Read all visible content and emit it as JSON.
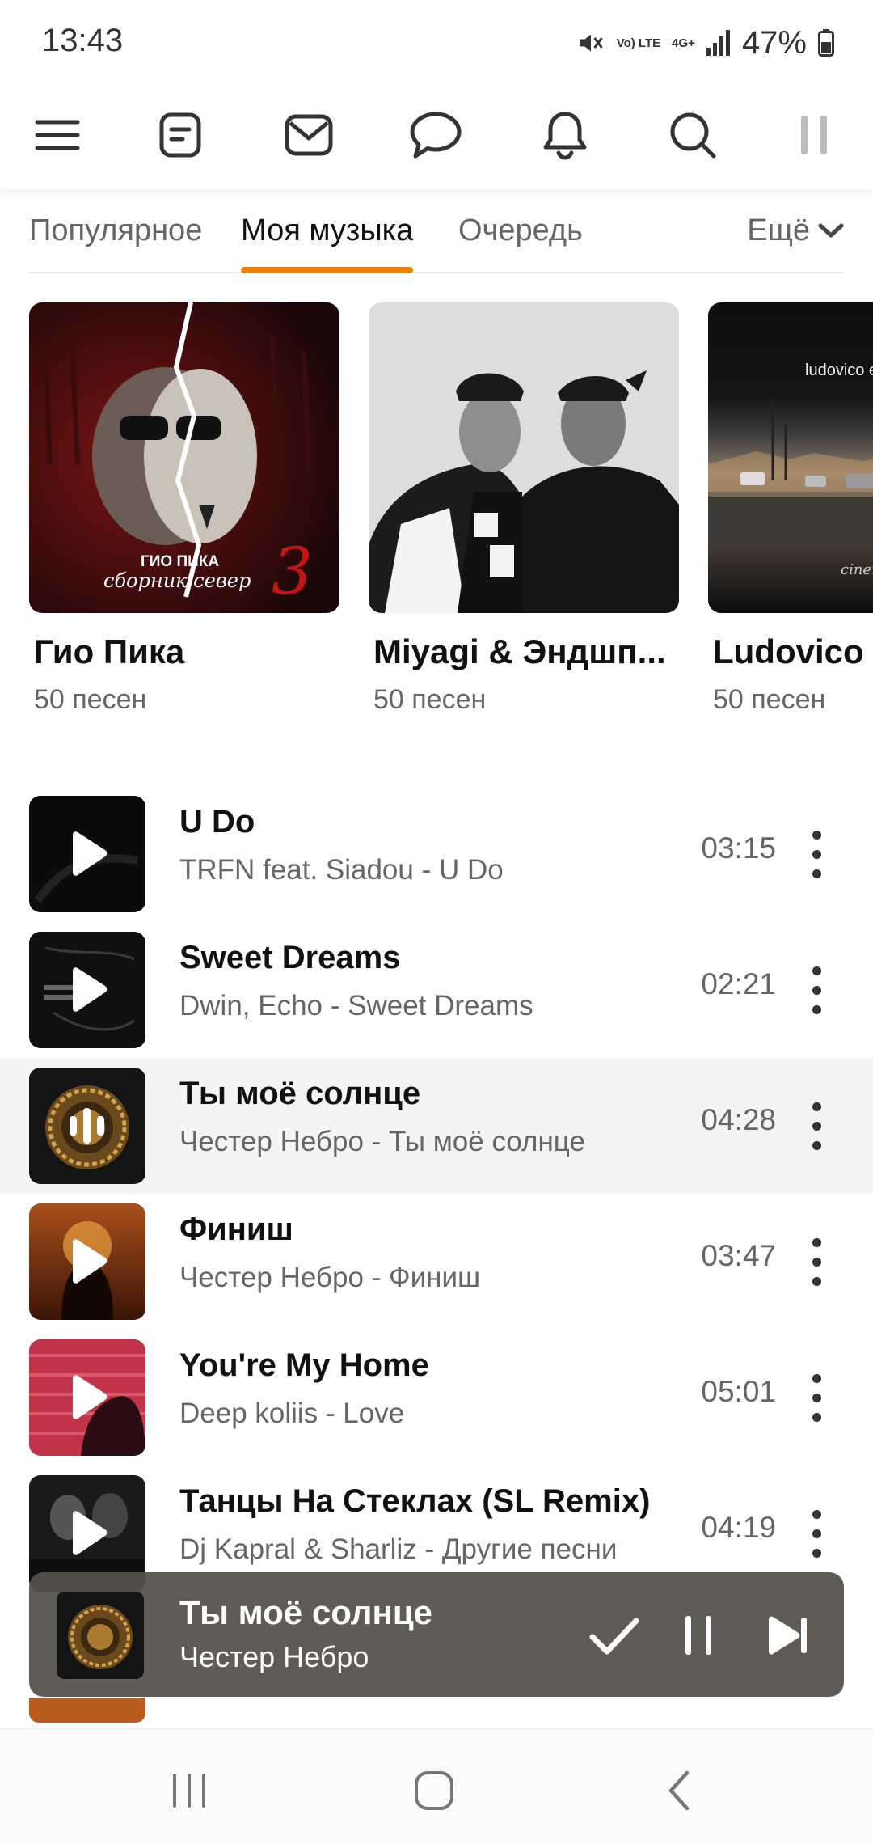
{
  "status_bar": {
    "time": "13:43",
    "lte_top": "Vo) LTE",
    "net_label": "4G+",
    "battery": "47%"
  },
  "toolbar": {
    "icons": [
      "menu-icon",
      "feed-icon",
      "mail-icon",
      "chat-icon",
      "bell-icon",
      "search-icon",
      "pause-icon"
    ]
  },
  "tabs": {
    "items": [
      "Популярное",
      "Моя музыка",
      "Очередь"
    ],
    "active_index": 1,
    "more_label": "Ещё"
  },
  "artist_cards": [
    {
      "title": "Гио Пика",
      "subtitle": "50 песен",
      "cover_text_1": "ГИО ПИКА",
      "cover_text_2": "сборник север",
      "cover_text_3": "3"
    },
    {
      "title": "Miyagi & Эндшп...",
      "subtitle": "50 песен"
    },
    {
      "title": "Ludovico I",
      "subtitle": "50 песен",
      "cover_text_1": "ludovico e",
      "cover_text_2": "cinem"
    }
  ],
  "tracks": [
    {
      "title": "U Do",
      "artist": "TRFN feat. Siadou - U Do",
      "duration": "03:15",
      "state": "play"
    },
    {
      "title": "Sweet Dreams",
      "artist": "Dwin, Echo - Sweet Dreams",
      "duration": "02:21",
      "state": "play"
    },
    {
      "title": "Ты моё солнце",
      "artist": "Честер Небро - Ты моё солнце",
      "duration": "04:28",
      "state": "playing"
    },
    {
      "title": "Финиш",
      "artist": "Честер Небро - Финиш",
      "duration": "03:47",
      "state": "play"
    },
    {
      "title": "You're My Home",
      "artist": "Deep koliis - Love",
      "duration": "05:01",
      "state": "play"
    },
    {
      "title": "Танцы На Стеклах (SL Remix)",
      "artist": "Dj Kapral & Sharliz - Другие песни",
      "duration": "04:19",
      "state": "play"
    }
  ],
  "now_playing": {
    "title": "Ты моё солнце",
    "artist": "Честер Небро"
  },
  "colors": {
    "accent": "#ee8208",
    "mini_player_bg": "#55524c"
  }
}
